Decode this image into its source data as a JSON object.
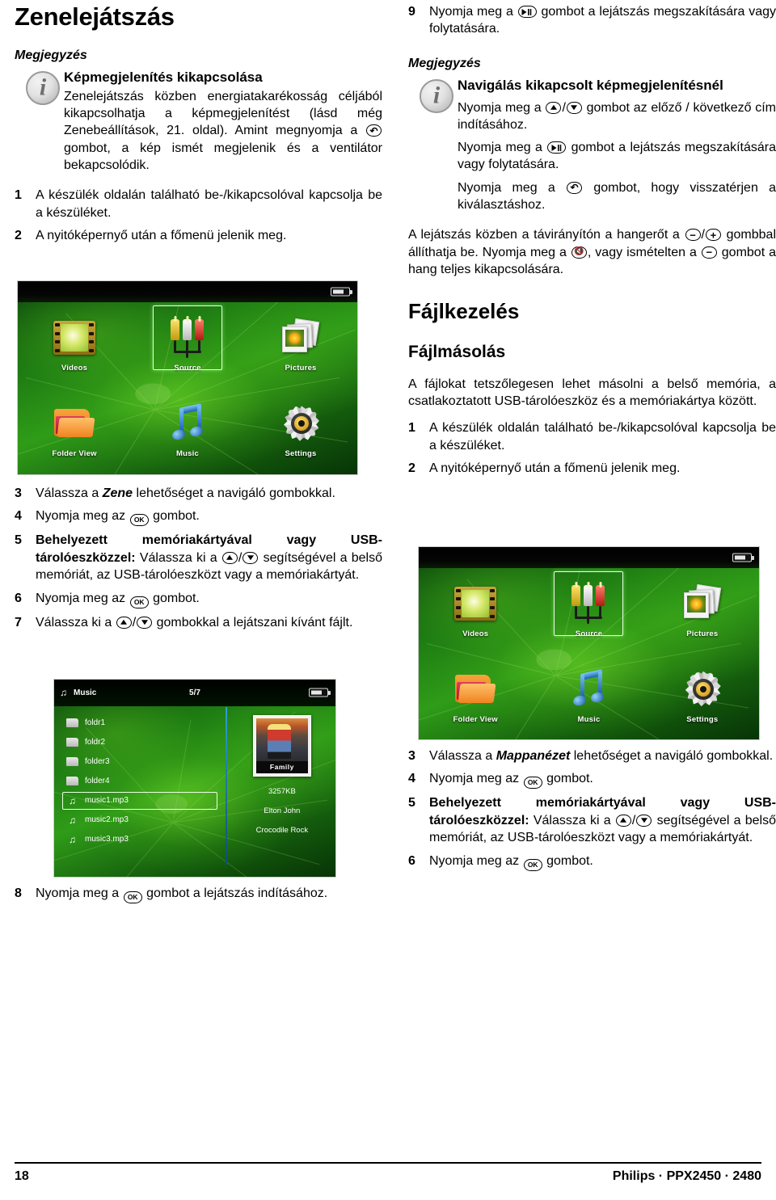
{
  "left_column": {
    "title": "Zenelejátszás",
    "note_label": "Megjegyzés",
    "note_title": "Képmegjelenítés kikapcsolása",
    "note_body_1": "Zenelejátszás közben energiatakarékosság céljából kikapcsolhatja a képmegjelenítést (lásd még Zenebeállítások, 21. oldal). Amint megnyomja a",
    "note_body_2": "gombot, a kép ismét megjelenik és a ventilátor bekapcsolódik.",
    "steps_1_2": [
      {
        "num": "1",
        "text": "A készülék oldalán található be-/kikapcsolóval kapcsolja be a készüléket."
      },
      {
        "num": "2",
        "text": "A nyitóképernyő után a főmenü jelenik meg."
      }
    ],
    "step3_num": "3",
    "step3_a": "Válassza a",
    "step3_bold": "Zene",
    "step3_b": "lehetőséget a navigáló gombokkal.",
    "step4_num": "4",
    "step4_a": "Nyomja meg az",
    "step4_b": "gombot.",
    "step5_num": "5",
    "step5_bold": "Behelyezett memóriakártyával vagy USB-tárolóeszközzel:",
    "step5_a": "Válassza ki a",
    "step5_b": "/",
    "step5_c": "segítségével a belső memóriát, az USB-tárolóeszközt vagy a memóriakártyát.",
    "step6_num": "6",
    "step6_a": "Nyomja meg az",
    "step6_b": "gombot.",
    "step7_num": "7",
    "step7_a": "Válassza ki a",
    "step7_b": "gombokkal a lejátszani kívánt fájlt.",
    "step8_num": "8",
    "step8_a": "Nyomja meg a",
    "step8_b": "gombot a lejátszás indításához."
  },
  "right_column": {
    "step9_num": "9",
    "step9_a": "Nyomja meg a",
    "step9_b": "gombot a lejátszás megszakítására vagy folytatására.",
    "note_label": "Megjegyzés",
    "note_title": "Navigálás kikapcsolt képmegjelenítésnél",
    "note_p1_a": "Nyomja meg a",
    "note_p1_b": "gombot az előző / következő cím indításához.",
    "note_p2_a": "Nyomja meg a",
    "note_p2_b": "gombot a lejátszás megszakítására vagy folytatására.",
    "note_p3_a": "Nyomja meg a",
    "note_p3_b": "gombot, hogy visszatérjen a kiválasztáshoz.",
    "volume_a": "A lejátszás közben a távirányítón a hangerőt a",
    "volume_b": "gombbal állíthatja be. Nyomja meg a",
    "volume_c": ", vagy ismételten a",
    "volume_d": "gombot a hang teljes kikapcsolására.",
    "section_title": "Fájlkezelés",
    "subsection_title": "Fájlmásolás",
    "intro": "A fájlokat tetszőlegesen lehet másolni a belső memória, a csatlakoztatott USB-tárolóeszköz és a memóriakártya között.",
    "steps_1_2": [
      {
        "num": "1",
        "text": "A készülék oldalán található be-/kikapcsolóval kapcsolja be a készüléket."
      },
      {
        "num": "2",
        "text": "A nyitóképernyő után a főmenü jelenik meg."
      }
    ],
    "step3_num": "3",
    "step3_a": "Válassza a",
    "step3_bold": "Mappanézet",
    "step3_b": "lehetőséget a navigáló gombokkal.",
    "step4_num": "4",
    "step4_a": "Nyomja meg az",
    "step4_b": "gombot.",
    "step5_num": "5",
    "step5_bold": "Behelyezett memóriakártyával vagy USB-tárolóeszközzel:",
    "step5_a": "Válassza ki a",
    "step5_c": "segítségével a belső memóriát, az USB-tárolóeszközt vagy a memóriakártyát.",
    "step6_num": "6",
    "step6_a": "Nyomja meg az",
    "step6_b": "gombot."
  },
  "keys": {
    "ok": "OK",
    "up": "up-arrow-key",
    "down": "down-arrow-key",
    "play_pause": "play-pause-key",
    "return": "return-key",
    "plus": "+",
    "minus": "–",
    "mute": "mute-key",
    "slash": "/"
  },
  "main_menu_screenshot": {
    "items": [
      {
        "label": "Videos",
        "icon": "video-icon",
        "selected": false
      },
      {
        "label": "Source",
        "icon": "source-icon",
        "selected": true
      },
      {
        "label": "Pictures",
        "icon": "pictures-icon",
        "selected": false
      },
      {
        "label": "Folder View",
        "icon": "folder-icon",
        "selected": false
      },
      {
        "label": "Music",
        "icon": "music-icon",
        "selected": false
      },
      {
        "label": "Settings",
        "icon": "gear-icon",
        "selected": false
      }
    ]
  },
  "music_browser_screenshot": {
    "header_title": "Music",
    "header_count": "5/7",
    "rows": [
      {
        "name": "foldr1",
        "type": "folder",
        "selected": false
      },
      {
        "name": "foldr2",
        "type": "folder",
        "selected": false
      },
      {
        "name": "folder3",
        "type": "folder",
        "selected": false
      },
      {
        "name": "folder4",
        "type": "folder",
        "selected": false
      },
      {
        "name": "music1.mp3",
        "type": "track",
        "selected": true
      },
      {
        "name": "music2.mp3",
        "type": "track",
        "selected": false
      },
      {
        "name": "music3.mp3",
        "type": "track",
        "selected": false
      }
    ],
    "cover_caption": "Family",
    "size": "3257KB",
    "artist": "Elton John",
    "track": "Crocodile Rock"
  },
  "footer": {
    "page_number": "18",
    "product": "Philips · PPX2450 · 2480"
  }
}
